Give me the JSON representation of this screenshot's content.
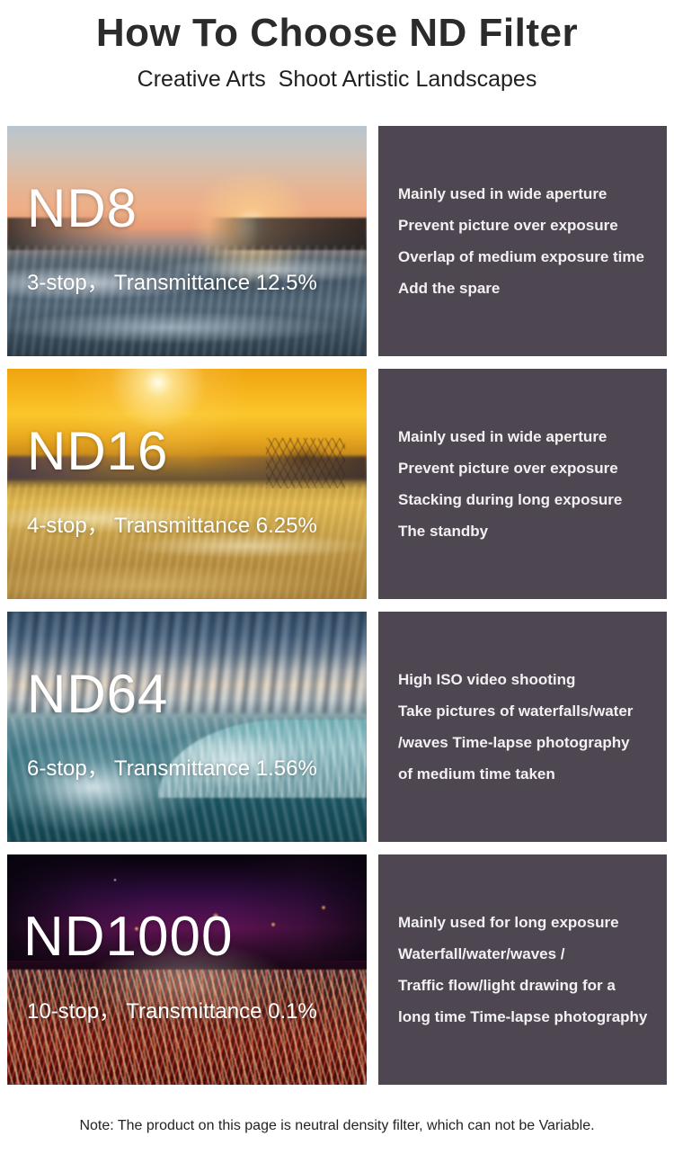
{
  "header": {
    "title": "How To Choose ND Filter",
    "subtitle": "Creative Arts  Shoot Artistic Landscapes"
  },
  "rows": [
    {
      "nd_label": "ND8",
      "spec": "3-stop， Transmittance 12.5%",
      "stops": "3-stop",
      "transmittance": "12.5%",
      "scene": "sunset-sea-photo",
      "info_lines": [
        "Mainly used in wide aperture",
        "Prevent picture over exposure",
        "Overlap of medium exposure time",
        "Add the spare"
      ]
    },
    {
      "nd_label": "ND16",
      "spec": "4-stop， Transmittance 6.25%",
      "stops": "4-stop",
      "transmittance": "6.25%",
      "scene": "golden-beach-photo",
      "info_lines": [
        "Mainly used in wide aperture",
        "Prevent picture over exposure",
        "Stacking during long exposure",
        "The standby"
      ]
    },
    {
      "nd_label": "ND64",
      "spec": "6-stop， Transmittance 1.56%",
      "stops": "6-stop",
      "transmittance": "1.56%",
      "scene": "waterfall-photo",
      "info_lines": [
        "High ISO video shooting",
        "Take pictures of waterfalls/water",
        "/waves  Time-lapse photography",
        "of medium time taken"
      ]
    },
    {
      "nd_label": "ND1000",
      "spec": "10-stop， Transmittance 0.1%",
      "stops": "10-stop",
      "transmittance": "0.1%",
      "scene": "night-traffic-photo",
      "info_lines": [
        "Mainly used for long exposure",
        "Waterfall/water/waves /",
        "Traffic flow/light drawing for a",
        "long time  Time-lapse photography"
      ]
    }
  ],
  "footer": {
    "note": "Note: The product on this page is neutral density filter, which can not be Variable."
  },
  "colors": {
    "panel_background": "#4E4751",
    "page_background": "#FFFFFF",
    "title_text": "#2B2B2B",
    "overlay_text": "#FFFFFF",
    "info_text": "#F2F0F2"
  }
}
